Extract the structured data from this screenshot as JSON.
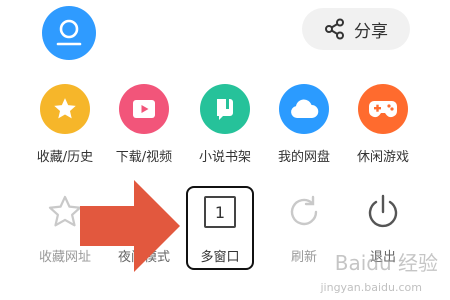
{
  "share": {
    "label": "分享"
  },
  "features": [
    {
      "label": "收藏/历史",
      "icon": "star-icon",
      "color": "#f6b62a"
    },
    {
      "label": "下载/视频",
      "icon": "play-video-icon",
      "color": "#f2557a"
    },
    {
      "label": "小说书架",
      "icon": "book-icon",
      "color": "#26c29a"
    },
    {
      "label": "我的网盘",
      "icon": "cloud-icon",
      "color": "#2b9bff"
    },
    {
      "label": "休闲游戏",
      "icon": "gamepad-icon",
      "color": "#ff6b2e"
    }
  ],
  "tools": [
    {
      "label": "收藏网址",
      "icon": "star-outline-icon"
    },
    {
      "label": "夜间模式",
      "icon": "moon-icon"
    },
    {
      "label": "多窗口",
      "icon": "window-count-icon",
      "count": "1"
    },
    {
      "label": "刷新",
      "icon": "refresh-icon"
    },
    {
      "label": "退出",
      "icon": "power-icon"
    }
  ],
  "watermark": {
    "brand": "Baidu 经验",
    "url": "jingyan.baidu.com"
  },
  "colors": {
    "accent_blue": "#2f9bff",
    "arrow": "#e2583e"
  }
}
